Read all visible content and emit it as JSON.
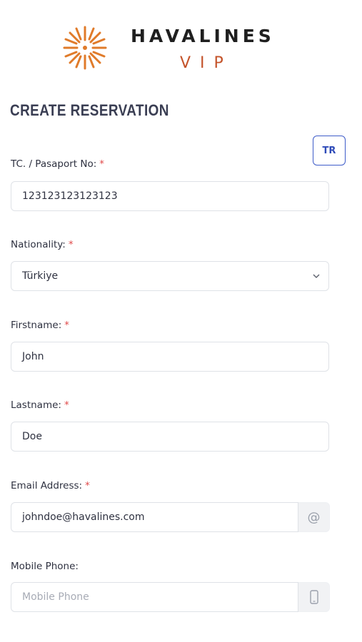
{
  "brand": {
    "name": "HAVALINES",
    "sub": "VIP",
    "accent": "#e07b2a",
    "sub_color": "#c4532a"
  },
  "page_title": "CREATE RESERVATION",
  "lang_button": "TR",
  "form": {
    "passport": {
      "label": "TC. / Pasaport No:",
      "required": "*",
      "value": "123123123123123"
    },
    "nationality": {
      "label": "Nationality:",
      "required": "*",
      "value": "Türkiye"
    },
    "firstname": {
      "label": "Firstname:",
      "required": "*",
      "value": "John"
    },
    "lastname": {
      "label": "Lastname:",
      "required": "*",
      "value": "Doe"
    },
    "email": {
      "label": "Email Address:",
      "required": "*",
      "value": "johndoe@havalines.com",
      "addon_icon": "at-icon",
      "addon_text": "@"
    },
    "phone": {
      "label": "Mobile Phone:",
      "placeholder": "Mobile Phone",
      "addon_icon": "mobile-phone-icon"
    }
  }
}
